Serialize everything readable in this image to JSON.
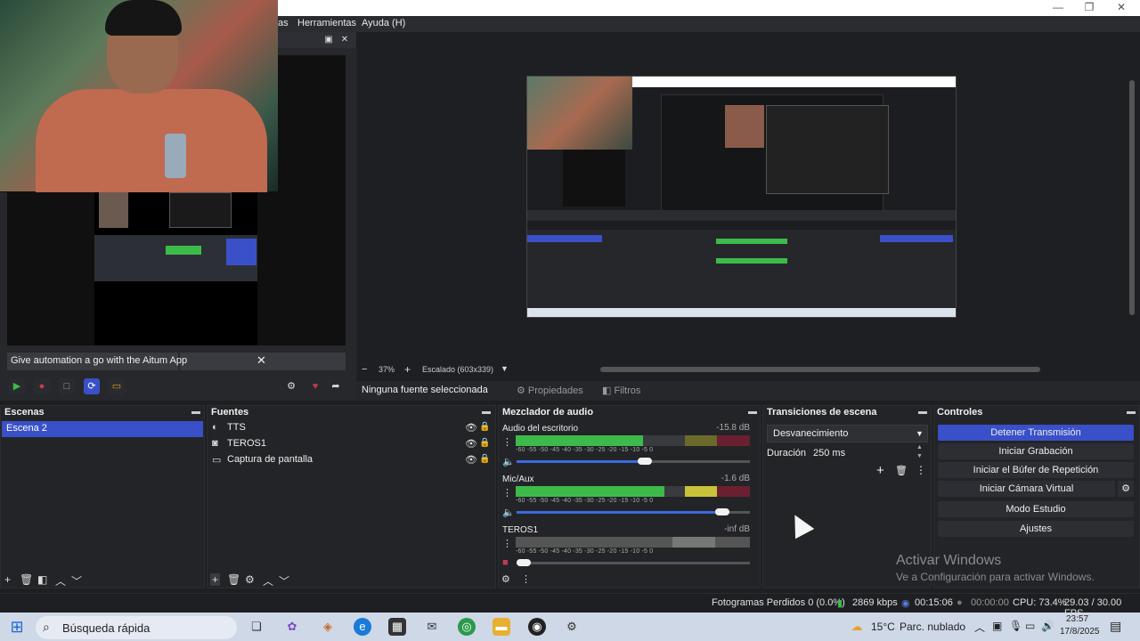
{
  "menubar": {
    "items": [
      "as",
      "Herramientas",
      "Ayuda (H)"
    ]
  },
  "browser_dock": {
    "aitum_text": "Give automation a go with the Aitum App",
    "close": "✕"
  },
  "preview": {
    "zoom_minus": "−",
    "zoom": "37%",
    "zoom_plus": "+",
    "scale_label": "Escalado (603x339)"
  },
  "propbar": {
    "no_source": "Ninguna fuente seleccionada",
    "properties": "Propiedades",
    "filters": "Filtros"
  },
  "scenes": {
    "title": "Escenas",
    "items": [
      "Escena 2"
    ]
  },
  "sources": {
    "title": "Fuentes",
    "items": [
      {
        "icon": "tts-icon",
        "label": "TTS"
      },
      {
        "icon": "camera-icon",
        "label": "TEROS1"
      },
      {
        "icon": "monitor-icon",
        "label": "Captura de pantalla"
      }
    ]
  },
  "mixer": {
    "title": "Mezclador de audio",
    "channels": [
      {
        "name": "Audio del escritorio",
        "db": "-15.8 dB",
        "level": 0.75,
        "volume": 0.55,
        "muted": false
      },
      {
        "name": "Mic/Aux",
        "db": "-1.6 dB",
        "level": 0.88,
        "volume": 0.88,
        "muted": false
      },
      {
        "name": "TEROS1",
        "db": "-inf dB",
        "level": 0.0,
        "volume": 0.0,
        "muted": true
      }
    ],
    "scale": "-60 -55 -50 -45 -40 -35 -30 -25 -20 -15 -10 -5 0"
  },
  "transitions": {
    "title": "Transiciones de escena",
    "selected": "Desvanecimiento",
    "duration_label": "Duración",
    "duration_value": "250 ms"
  },
  "controls": {
    "title": "Controles",
    "buttons": [
      "Detener Transmisión",
      "Iniciar Grabación",
      "Iniciar el Búfer de Repetición",
      "Iniciar Cámara Virtual",
      "Modo Estudio",
      "Ajustes"
    ]
  },
  "activate_windows": {
    "title": "Activar Windows",
    "subtitle": "Ve a Configuración para activar Windows."
  },
  "status": {
    "dropped": "Fotogramas Perdidos 0 (0.0%)",
    "bitrate": "2869 kbps",
    "stream_time": "00:15:06",
    "rec_time": "00:00:00",
    "cpu": "CPU: 73.4%",
    "fps": "29.03 / 30.00 FPS"
  },
  "taskbar": {
    "search": "Búsqueda rápida",
    "weather": "15°C",
    "weather_desc": "Parc. nublado",
    "time": "23:57",
    "date": "17/8/2025"
  },
  "colors": {
    "accent": "#3a50c8",
    "meter_green": "#3dbb4a",
    "meter_yellow": "#c9c23a",
    "meter_red": "#c33a4e"
  }
}
